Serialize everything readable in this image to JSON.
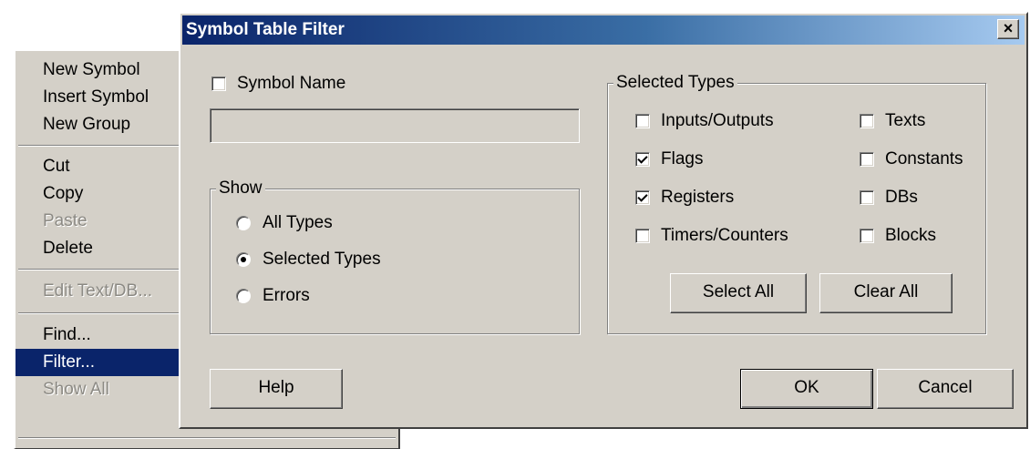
{
  "menu": {
    "items": [
      {
        "label": "New Symbol",
        "state": "normal"
      },
      {
        "label": "Insert Symbol",
        "state": "normal"
      },
      {
        "label": "New Group",
        "state": "normal"
      },
      {
        "label": "Cut",
        "state": "normal"
      },
      {
        "label": "Copy",
        "state": "normal"
      },
      {
        "label": "Paste",
        "state": "disabled"
      },
      {
        "label": "Delete",
        "state": "normal"
      },
      {
        "label": "Edit Text/DB...",
        "state": "disabled"
      },
      {
        "label": "Find...",
        "state": "normal"
      },
      {
        "label": "Filter...",
        "state": "selected"
      },
      {
        "label": "Show All",
        "state": "disabled"
      }
    ]
  },
  "dialog": {
    "title": "Symbol Table Filter",
    "close_glyph": "×",
    "symbol_name": {
      "label": "Symbol Name",
      "checked": false,
      "value": ""
    },
    "show": {
      "legend": "Show",
      "options": [
        {
          "label": "All Types",
          "checked": false
        },
        {
          "label": "Selected Types",
          "checked": true
        },
        {
          "label": "Errors",
          "checked": false
        }
      ]
    },
    "selected_types": {
      "legend": "Selected Types",
      "left": [
        {
          "label": "Inputs/Outputs",
          "checked": false
        },
        {
          "label": "Flags",
          "checked": true
        },
        {
          "label": "Registers",
          "checked": true
        },
        {
          "label": "Timers/Counters",
          "checked": false
        }
      ],
      "right": [
        {
          "label": "Texts",
          "checked": false
        },
        {
          "label": "Constants",
          "checked": false
        },
        {
          "label": "DBs",
          "checked": false
        },
        {
          "label": "Blocks",
          "checked": false
        }
      ],
      "select_all": "Select All",
      "clear_all": "Clear All"
    },
    "buttons": {
      "help": "Help",
      "ok": "OK",
      "cancel": "Cancel"
    }
  },
  "colors": {
    "face": "#d4d0c8",
    "highlight": "#0a246a",
    "title_gradient_start": "#0a246a",
    "title_gradient_end": "#a6caf0",
    "disabled_text": "#8c8a84"
  },
  "icons": {
    "close": "close-icon",
    "checkbox": "checkbox-icon",
    "radio": "radio-icon"
  }
}
